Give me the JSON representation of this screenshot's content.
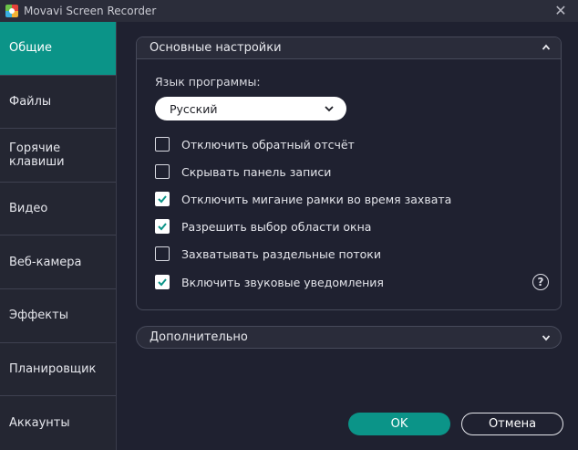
{
  "window": {
    "title": "Movavi Screen Recorder",
    "close_icon": "close-icon",
    "app_icon": "movavi-logo-icon"
  },
  "sidebar": {
    "items": [
      {
        "label": "Общие",
        "active": true
      },
      {
        "label": "Файлы",
        "active": false
      },
      {
        "label": "Горячие\nклавиши",
        "active": false
      },
      {
        "label": "Видео",
        "active": false
      },
      {
        "label": "Веб-камера",
        "active": false
      },
      {
        "label": "Эффекты",
        "active": false
      },
      {
        "label": "Планировщик",
        "active": false
      },
      {
        "label": "Аккаунты",
        "active": false
      }
    ]
  },
  "general": {
    "header": "Основные настройки",
    "expanded": true,
    "language_label": "Язык программы:",
    "language_value": "Русский",
    "options": [
      {
        "label": "Отключить обратный отсчёт",
        "checked": false
      },
      {
        "label": "Скрывать панель записи",
        "checked": false
      },
      {
        "label": "Отключить мигание рамки во время захвата",
        "checked": true
      },
      {
        "label": "Разрешить выбор области окна",
        "checked": true
      },
      {
        "label": "Захватывать раздельные потоки",
        "checked": false
      },
      {
        "label": "Включить звуковые уведомления",
        "checked": true
      }
    ],
    "help_symbol": "?"
  },
  "advanced": {
    "header": "Дополнительно",
    "expanded": false
  },
  "footer": {
    "ok_label": "OK",
    "cancel_label": "Отмена"
  },
  "colors": {
    "accent": "#0b9488",
    "background": "#1f2130",
    "sidebar": "#242632"
  }
}
